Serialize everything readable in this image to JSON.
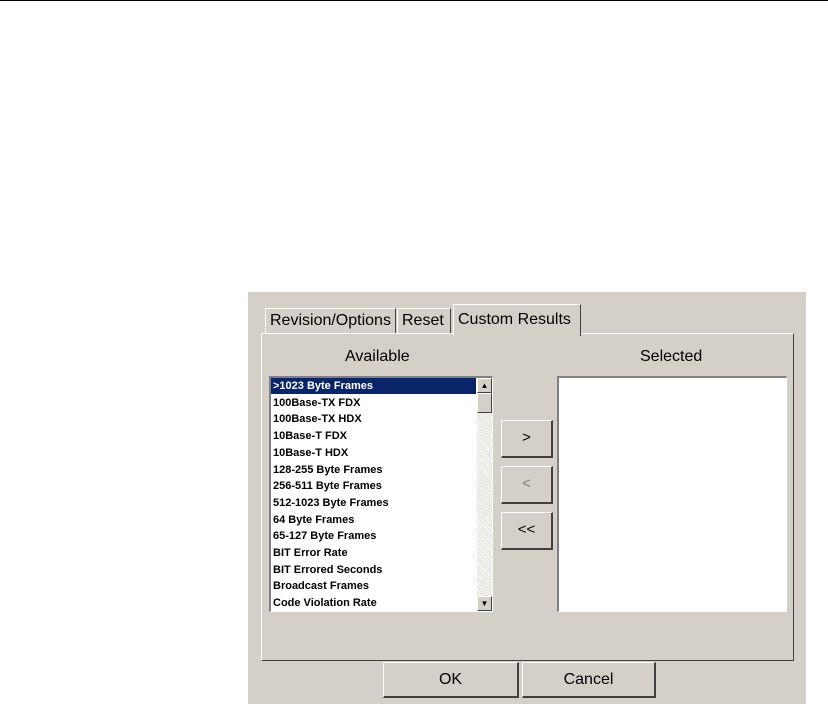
{
  "tabs": [
    {
      "label": "Revision/Options",
      "active": false
    },
    {
      "label": "Reset",
      "active": false
    },
    {
      "label": "Custom Results",
      "active": true
    }
  ],
  "available_label": "Available",
  "selected_label": "Selected",
  "available_items": [
    ">1023 Byte Frames",
    "100Base-TX FDX",
    "100Base-TX HDX",
    "10Base-T FDX",
    "10Base-T HDX",
    "128-255 Byte Frames",
    "256-511 Byte Frames",
    "512-1023 Byte Frames",
    "64 Byte Frames",
    "65-127 Byte Frames",
    "BIT Error Rate",
    "BIT Errored Seconds",
    "Broadcast Frames",
    "Code Violation Rate"
  ],
  "selected_index": 0,
  "selected_items": [],
  "buttons": {
    "add": ">",
    "remove": "<",
    "remove_all": "<<",
    "ok": "OK",
    "cancel": "Cancel"
  },
  "icons": {
    "scroll_up": "scroll-up-arrow-icon",
    "scroll_down": "scroll-down-arrow-icon"
  },
  "colors": {
    "selection": "#0a246a",
    "dialog_bg": "#d4d0c8"
  }
}
